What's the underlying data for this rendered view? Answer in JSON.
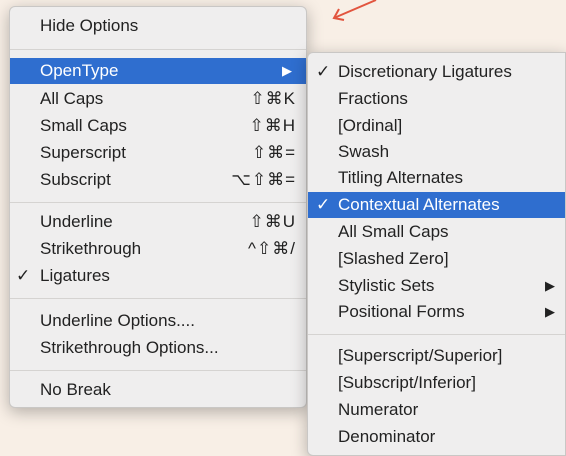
{
  "main_menu": {
    "items": [
      {
        "label": "Hide Options",
        "shortcut": "",
        "check": "",
        "arrow": ""
      },
      {
        "label": "OpenType",
        "shortcut": "",
        "check": "",
        "arrow": "▶"
      },
      {
        "label": "All Caps",
        "shortcut": "⇧⌘K",
        "check": "",
        "arrow": ""
      },
      {
        "label": "Small Caps",
        "shortcut": "⇧⌘H",
        "check": "",
        "arrow": ""
      },
      {
        "label": "Superscript",
        "shortcut": "⇧⌘=",
        "check": "",
        "arrow": ""
      },
      {
        "label": "Subscript",
        "shortcut": "⌥⇧⌘=",
        "check": "",
        "arrow": ""
      },
      {
        "label": "Underline",
        "shortcut": "⇧⌘U",
        "check": "",
        "arrow": ""
      },
      {
        "label": "Strikethrough",
        "shortcut": "^⇧⌘/",
        "check": "",
        "arrow": ""
      },
      {
        "label": "Ligatures",
        "shortcut": "",
        "check": "✓",
        "arrow": ""
      },
      {
        "label": "Underline Options....",
        "shortcut": "",
        "check": "",
        "arrow": ""
      },
      {
        "label": "Strikethrough Options...",
        "shortcut": "",
        "check": "",
        "arrow": ""
      },
      {
        "label": "No Break",
        "shortcut": "",
        "check": "",
        "arrow": ""
      }
    ]
  },
  "submenu": {
    "items": [
      {
        "label": "Discretionary Ligatures",
        "check": "✓",
        "arrow": ""
      },
      {
        "label": "Fractions",
        "check": "",
        "arrow": ""
      },
      {
        "label": "[Ordinal]",
        "check": "",
        "arrow": ""
      },
      {
        "label": "Swash",
        "check": "",
        "arrow": ""
      },
      {
        "label": "Titling Alternates",
        "check": "",
        "arrow": ""
      },
      {
        "label": "Contextual Alternates",
        "check": "✓",
        "arrow": ""
      },
      {
        "label": "All Small Caps",
        "check": "",
        "arrow": ""
      },
      {
        "label": "[Slashed Zero]",
        "check": "",
        "arrow": ""
      },
      {
        "label": "Stylistic Sets",
        "check": "",
        "arrow": "▶"
      },
      {
        "label": "Positional Forms",
        "check": "",
        "arrow": "▶"
      },
      {
        "label": "[Superscript/Superior]",
        "check": "",
        "arrow": ""
      },
      {
        "label": "[Subscript/Inferior]",
        "check": "",
        "arrow": ""
      },
      {
        "label": "Numerator",
        "check": "",
        "arrow": ""
      },
      {
        "label": "Denominator",
        "check": "",
        "arrow": ""
      }
    ]
  },
  "colors": {
    "selection": "#2f6ecf",
    "annotation_arrow": "#e2553f",
    "background": "#f8efe6"
  },
  "icons": [
    "checkmark-icon",
    "submenu-arrow-icon",
    "annotation-arrow-icon"
  ]
}
